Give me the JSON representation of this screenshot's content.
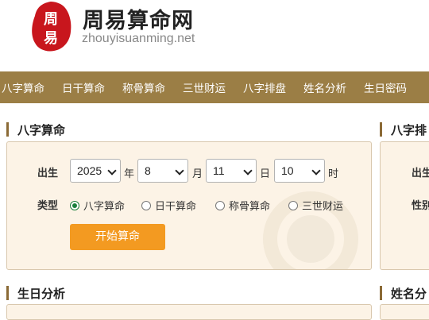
{
  "header": {
    "title": "周易算命网",
    "url": "zhouyisuanming.net",
    "logo_text": "周易",
    "logo_color": "#c8161d"
  },
  "nav": {
    "items": [
      "八字算命",
      "日干算命",
      "称骨算命",
      "三世财运",
      "八字排盘",
      "姓名分析",
      "生日密码"
    ],
    "background": "#9b7e45"
  },
  "bazi_form": {
    "title": "八字算命",
    "birth_label": "出生",
    "year_value": "2025",
    "year_unit": "年",
    "month_value": "8",
    "month_unit": "月",
    "day_value": "11",
    "day_unit": "日",
    "hour_value": "10",
    "hour_unit": "时",
    "type_label": "类型",
    "types": [
      "八字算命",
      "日干算命",
      "称骨算命",
      "三世财运"
    ],
    "selected_type": "八字算命",
    "submit_label": "开始算命",
    "accent": "#f39a21"
  },
  "right_card": {
    "title": "八字排",
    "birth_label": "出生",
    "gender_label": "性别"
  },
  "bottom_left": {
    "title": "生日分析"
  },
  "bottom_right": {
    "title": "姓名分"
  }
}
